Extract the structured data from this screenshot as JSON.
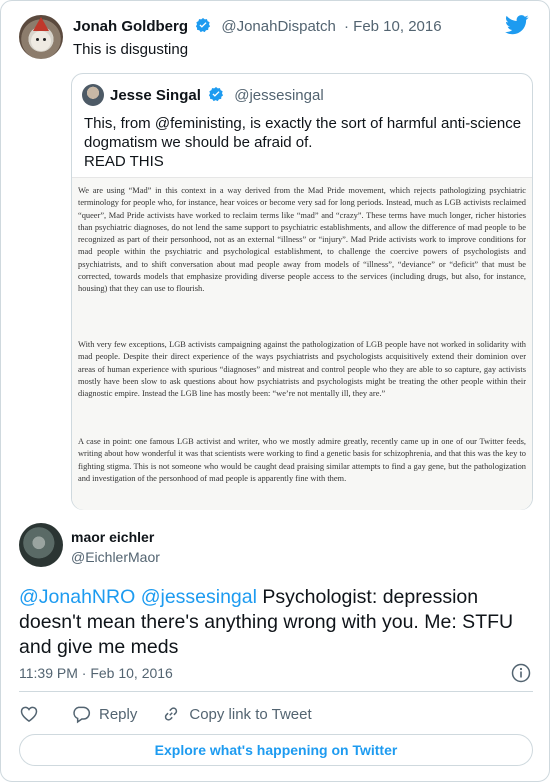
{
  "tweet": {
    "author_name": "Jonah Goldberg",
    "author_handle": "@JonahDispatch",
    "date": "· Feb 10, 2016",
    "text": "This is disgusting"
  },
  "quoted": {
    "author_name": "Jesse Singal",
    "author_handle": "@jessesingal",
    "text_line1": "This, from @feministing, is exactly the sort of harmful anti-science dogmatism we should be afraid of.",
    "text_line2": "READ THIS",
    "image_paragraphs": [
      "We are using “Mad” in this context in a way derived from the Mad Pride movement, which rejects pathologizing psychiatric terminology for people who, for instance, hear voices or become very sad for long periods. Instead, much as LGB activists reclaimed “queer”, Mad Pride activists have worked to reclaim terms like “mad” and “crazy”. These terms have much longer, richer histories than psychiatric diagnoses, do not lend the same support to psychiatric establishments, and allow the difference of mad people to be recognized as part of their personhood, not as an external “illness” or “injury”. Mad Pride activists work to improve conditions for mad people within the psychiatric and psychological establishment, to challenge the coercive powers of psychologists and psychiatrists, and to shift conversation about mad people away from models of “illness”, “deviance” or “deficit” that must be corrected, towards models that emphasize providing diverse people access to the services (including drugs, but also, for instance, housing) that they can use to flourish.",
      "With very few exceptions, LGB activists campaigning against the pathologization of LGB people have not worked in solidarity with mad people. Despite their direct experience of the ways psychiatrists and psychologists acquisitively extend their dominion over areas of human experience with spurious “diagnoses” and mistreat and control people who they are able to so capture, gay activists mostly have been slow to ask questions about how psychiatrists and psychologists might be treating the other people within their diagnostic empire. Instead the LGB line has mostly been: “we’re not mentally ill, they are.”",
      "A case in point: one famous LGB activist and writer, who we mostly admire greatly, recently came up in one of our Twitter feeds, writing about how wonderful it was that scientists were working to find a genetic basis for schizophrenia, and that this was the key to fighting stigma. This is not someone who would be caught dead praising similar attempts to find a gay gene, but the pathologization and investigation of the personhood of mad people is apparently fine with them."
    ]
  },
  "reply": {
    "author_name": "maor eichler",
    "author_handle": "@EichlerMaor",
    "mention1": "@JonahNRO",
    "mention2": "@jessesingal",
    "text": " Psychologist: depression doesn't mean there's anything wrong with you. Me: STFU and give me meds",
    "timestamp": "11:39 PM · Feb 10, 2016"
  },
  "actions": {
    "reply_label": "Reply",
    "copy_label": "Copy link to Tweet"
  },
  "explore_label": "Explore what's happening on Twitter",
  "icons": {
    "brand": "twitter-bird-icon",
    "verified": "verified-badge-icon",
    "like": "heart-icon",
    "reply": "comment-icon",
    "copy": "link-icon",
    "info": "info-icon"
  },
  "colors": {
    "accent": "#1d9bf0",
    "text": "#0f1419",
    "muted": "#536471",
    "border": "#cfd9de"
  }
}
